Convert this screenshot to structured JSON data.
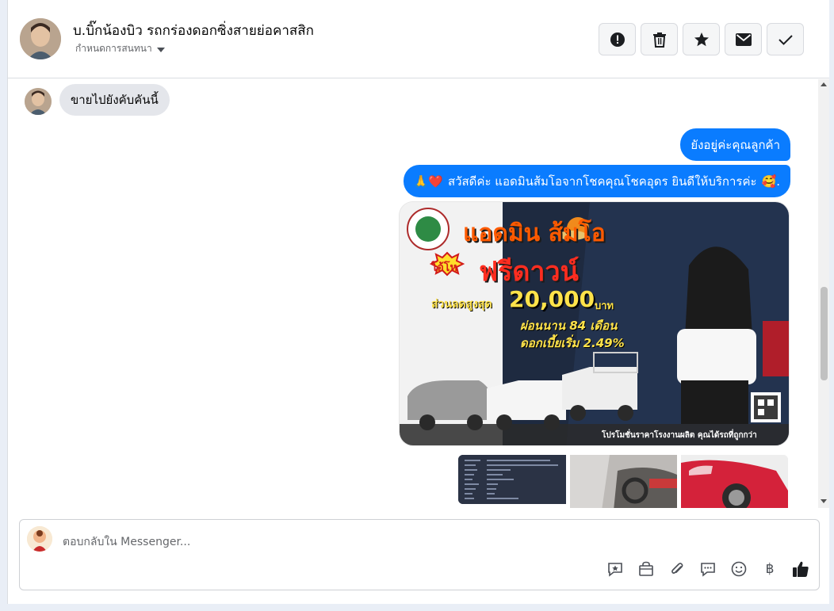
{
  "conversation": {
    "contact_name": "บ.บิ๊กน้องบิว รถกร่องดอกซิ่งสายย่อคาสสิก",
    "subtitle": "กำหนดการสนทนา"
  },
  "header_actions": [
    {
      "icon": "alert-icon"
    },
    {
      "icon": "trash-icon"
    },
    {
      "icon": "star-icon"
    },
    {
      "icon": "mail-icon"
    },
    {
      "icon": "check-icon"
    }
  ],
  "messages": {
    "incoming_1": "ขายไปยังคับคันนี้",
    "outgoing_1": "ยังอยู่ค่ะคุณลูกค้า",
    "outgoing_2_prefix": "🙏❤️",
    "outgoing_2_text": "สวัสดีค่ะ แอดมินส้มโอจากโชคคุณโชคอุดร ยินดีให้บริการค่ะ",
    "outgoing_2_suffix": "🥰."
  },
  "promo_image": {
    "title": "แอดมิน ส้มโอ",
    "freedown": "ฟรีดาวน์",
    "ohho": "โอ้โห",
    "discount_label": "ส่วนลดสูงสุด",
    "discount_amount": "20,000",
    "discount_unit": "บาท",
    "installment": "ผ่อนนาน 84 เดือน",
    "interest": "ดอกเบี้ยเริ่ม 2.49%",
    "footer": "โปรโมชั่นราคาโรงงานผลิต คุณได้รถที่ถูกกว่า"
  },
  "composer": {
    "placeholder": "ตอบกลับใน Messenger..."
  },
  "composer_tools": [
    "saved-reply-icon",
    "shop-icon",
    "attachment-icon",
    "chat-icon",
    "emoji-icon",
    "baht-icon",
    "like-icon"
  ]
}
